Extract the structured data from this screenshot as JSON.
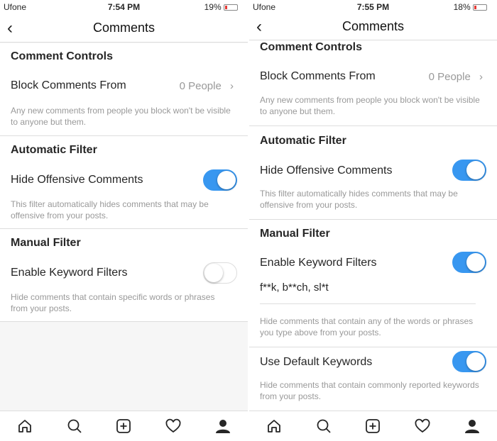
{
  "left": {
    "status": {
      "carrier": "Ufone",
      "time": "7:54 PM",
      "battery": "19%",
      "battery_level": 0.19
    },
    "nav": {
      "title": "Comments"
    },
    "sections": {
      "controls": {
        "title": "Comment Controls",
        "row": "Block Comments From",
        "value": "0 People",
        "desc": "Any new comments from people you block won't be visible to anyone but them."
      },
      "auto": {
        "title": "Automatic Filter",
        "row": "Hide Offensive Comments",
        "on": true,
        "desc": "This filter automatically hides comments that may be offensive from your posts."
      },
      "manual": {
        "title": "Manual Filter",
        "row": "Enable Keyword Filters",
        "on": false,
        "desc": "Hide comments that contain specific words or phrases from your posts."
      }
    }
  },
  "right": {
    "status": {
      "carrier": "Ufone",
      "time": "7:55 PM",
      "battery": "18%",
      "battery_level": 0.18
    },
    "nav": {
      "title": "Comments"
    },
    "sections": {
      "controls": {
        "title": "Comment Controls",
        "row": "Block Comments From",
        "value": "0 People",
        "desc": "Any new comments from people you block won't be visible to anyone but them."
      },
      "auto": {
        "title": "Automatic Filter",
        "row": "Hide Offensive Comments",
        "on": true,
        "desc": "This filter automatically hides comments that may be offensive from your posts."
      },
      "manual": {
        "title": "Manual Filter",
        "row": "Enable Keyword Filters",
        "on": true,
        "keywords": "f**k, b**ch, sl*t",
        "desc": "Hide comments that contain any of the words or phrases you type above from your posts."
      },
      "default": {
        "row": "Use Default Keywords",
        "on": true,
        "desc": "Hide comments that contain commonly reported keywords from your posts."
      }
    }
  },
  "tabbar": [
    "home-icon",
    "search-icon",
    "add-icon",
    "heart-icon",
    "profile-icon"
  ],
  "colors": {
    "accent": "#3897f0",
    "battery_low": "#e53935"
  }
}
